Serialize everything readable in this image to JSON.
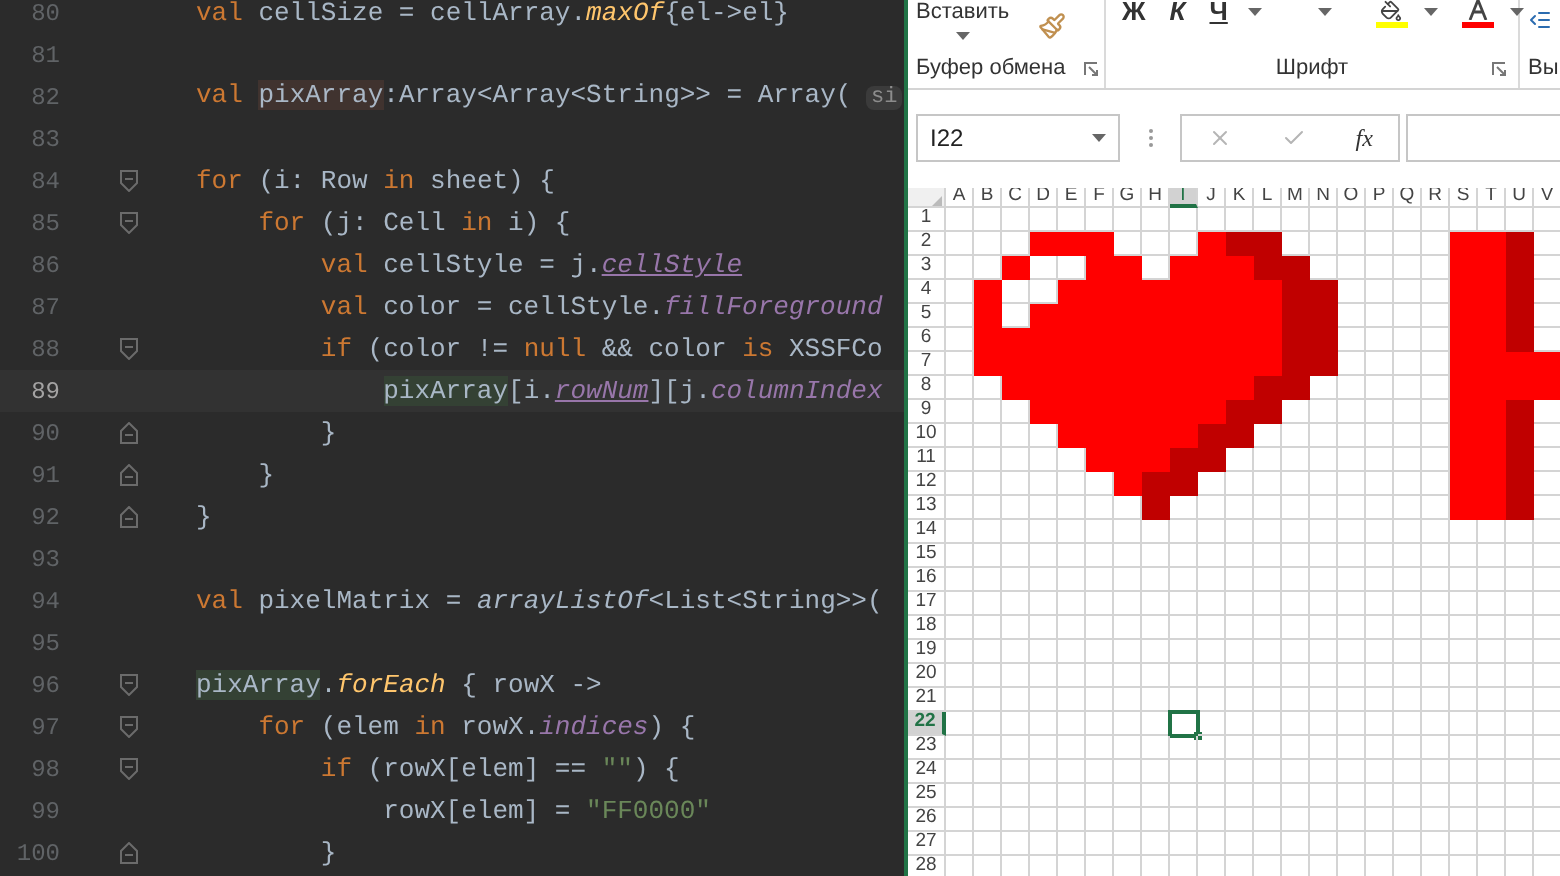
{
  "editor": {
    "lines": [
      {
        "number": "80",
        "fold_start": false,
        "fold_end": false,
        "current": false,
        "tokens": [
          {
            "kind": "keyword",
            "text": "val"
          },
          {
            "kind": "plain",
            "text": " cellSize = cellArray."
          },
          {
            "kind": "function",
            "text": "maxOf"
          },
          {
            "kind": "plain",
            "text": "{el->el}"
          }
        ]
      },
      {
        "number": "81",
        "fold_start": false,
        "fold_end": false,
        "current": false
      },
      {
        "number": "82",
        "fold_start": false,
        "fold_end": false,
        "current": false,
        "tokens": [
          {
            "kind": "keyword",
            "text": "val "
          },
          {
            "kind": "declaration",
            "text": "pixArray"
          },
          {
            "kind": "plain",
            "text": ":Array<Array<String>> = Array( "
          },
          {
            "kind": "hint",
            "text": "si"
          }
        ]
      },
      {
        "number": "83",
        "fold_start": false,
        "fold_end": false,
        "current": false
      },
      {
        "number": "84",
        "fold_start": true,
        "fold_end": false,
        "current": false,
        "tokens": [
          {
            "kind": "keyword",
            "text": "for"
          },
          {
            "kind": "plain",
            "text": " (i: Row "
          },
          {
            "kind": "keyword",
            "text": "in"
          },
          {
            "kind": "plain",
            "text": " sheet) {"
          }
        ],
        "children": [
          {
            "number": "85",
            "fold_start": true,
            "fold_end": false,
            "current": false,
            "tokens": [
              {
                "kind": "keyword",
                "text": "for"
              },
              {
                "kind": "plain",
                "text": " (j: Cell "
              },
              {
                "kind": "keyword",
                "text": "in"
              },
              {
                "kind": "plain",
                "text": " i) {"
              }
            ],
            "children": [
              {
                "number": "86",
                "fold_start": false,
                "fold_end": false,
                "current": false,
                "tokens": [
                  {
                    "kind": "keyword",
                    "text": "val"
                  },
                  {
                    "kind": "plain",
                    "text": " cellStyle = j."
                  },
                  {
                    "kind": "property-underlined",
                    "text": "cellStyle"
                  }
                ]
              },
              {
                "number": "87",
                "fold_start": false,
                "fold_end": false,
                "current": false,
                "tokens": [
                  {
                    "kind": "keyword",
                    "text": "val"
                  },
                  {
                    "kind": "plain",
                    "text": " color = cellStyle."
                  },
                  {
                    "kind": "property",
                    "text": "fillForeground"
                  }
                ]
              },
              {
                "number": "88",
                "fold_start": true,
                "fold_end": false,
                "current": false,
                "tokens": [
                  {
                    "kind": "keyword",
                    "text": "if"
                  },
                  {
                    "kind": "plain",
                    "text": " (color != "
                  },
                  {
                    "kind": "keyword",
                    "text": "null"
                  },
                  {
                    "kind": "plain",
                    "text": " && color "
                  },
                  {
                    "kind": "keyword",
                    "text": "is"
                  },
                  {
                    "kind": "plain",
                    "text": " XSSFCo"
                  }
                ],
                "children": [
                  {
                    "number": "89",
                    "fold_start": false,
                    "fold_end": false,
                    "current": true,
                    "tokens": [
                      {
                        "kind": "usage",
                        "text": "pixArray"
                      },
                      {
                        "kind": "plain",
                        "text": "[i."
                      },
                      {
                        "kind": "property-underlined",
                        "text": "rowNum"
                      },
                      {
                        "kind": "plain",
                        "text": "][j."
                      },
                      {
                        "kind": "property",
                        "text": "columnIndex"
                      }
                    ]
                  }
                ]
              },
              {
                "number": "90",
                "fold_start": false,
                "fold_end": true,
                "current": false,
                "tokens": [
                  {
                    "kind": "plain",
                    "text": "}"
                  }
                ]
              }
            ]
          },
          {
            "number": "91",
            "fold_start": false,
            "fold_end": true,
            "current": false,
            "tokens": [
              {
                "kind": "plain",
                "text": "}"
              }
            ]
          }
        ]
      },
      {
        "number": "92",
        "fold_start": false,
        "fold_end": true,
        "current": false,
        "tokens": [
          {
            "kind": "plain",
            "text": "}"
          }
        ]
      },
      {
        "number": "93",
        "fold_start": false,
        "fold_end": false,
        "current": false
      },
      {
        "number": "94",
        "fold_start": false,
        "fold_end": false,
        "current": false,
        "tokens": [
          {
            "kind": "keyword",
            "text": "val"
          },
          {
            "kind": "plain",
            "text": " pixelMatrix = "
          },
          {
            "kind": "static-function",
            "text": "arrayListOf"
          },
          {
            "kind": "plain",
            "text": "<List<String>>("
          }
        ]
      },
      {
        "number": "95",
        "fold_start": false,
        "fold_end": false,
        "current": false
      },
      {
        "number": "96",
        "fold_start": true,
        "fold_end": false,
        "current": false,
        "tokens": [
          {
            "kind": "usage",
            "text": "pixArray"
          },
          {
            "kind": "plain",
            "text": "."
          },
          {
            "kind": "function",
            "text": "forEach"
          },
          {
            "kind": "plain",
            "text": " { rowX ->"
          }
        ],
        "children": [
          {
            "number": "97",
            "fold_start": true,
            "fold_end": false,
            "current": false,
            "tokens": [
              {
                "kind": "keyword",
                "text": "for"
              },
              {
                "kind": "plain",
                "text": " (elem "
              },
              {
                "kind": "keyword",
                "text": "in"
              },
              {
                "kind": "plain",
                "text": " rowX."
              },
              {
                "kind": "property",
                "text": "indices"
              },
              {
                "kind": "plain",
                "text": ") {"
              }
            ],
            "children": [
              {
                "number": "98",
                "fold_start": true,
                "fold_end": false,
                "current": false,
                "tokens": [
                  {
                    "kind": "keyword",
                    "text": "if"
                  },
                  {
                    "kind": "plain",
                    "text": " (rowX[elem] == "
                  },
                  {
                    "kind": "string",
                    "text": "\"\""
                  },
                  {
                    "kind": "plain",
                    "text": ") {"
                  }
                ],
                "children": [
                  {
                    "number": "99",
                    "fold_start": false,
                    "fold_end": false,
                    "current": false,
                    "tokens": [
                      {
                        "kind": "plain",
                        "text": "rowX[elem] = "
                      },
                      {
                        "kind": "string",
                        "text": "\"FF0000\""
                      }
                    ]
                  }
                ]
              },
              {
                "number": "100",
                "fold_start": false,
                "fold_end": true,
                "current": false,
                "tokens": [
                  {
                    "kind": "plain",
                    "text": "}"
                  }
                ]
              }
            ]
          }
        ]
      }
    ]
  },
  "excel": {
    "ribbon": {
      "groups": [
        {
          "kind": "clipboard",
          "label": "Буфер обмена",
          "paste_label": "Вставить"
        },
        {
          "kind": "font",
          "label": "Шрифт",
          "format_buttons": [
            {
              "kind": "bold",
              "text": "Ж"
            },
            {
              "kind": "italic",
              "text": "К"
            },
            {
              "kind": "underline",
              "text": "Ч"
            }
          ],
          "fill_color": {
            "color": "#ffff00"
          },
          "font_color": {
            "color": "#ff0000"
          }
        },
        {
          "kind": "partial",
          "label": "Вы"
        }
      ]
    },
    "name_box": {
      "value": "I22"
    },
    "formula_bar": {
      "function_label": "fx"
    },
    "columns": [
      {
        "label": "A",
        "selected": false
      },
      {
        "label": "B",
        "selected": false
      },
      {
        "label": "C",
        "selected": false
      },
      {
        "label": "D",
        "selected": false
      },
      {
        "label": "E",
        "selected": false
      },
      {
        "label": "F",
        "selected": false
      },
      {
        "label": "G",
        "selected": false
      },
      {
        "label": "H",
        "selected": false
      },
      {
        "label": "I",
        "selected": true
      },
      {
        "label": "J",
        "selected": false
      },
      {
        "label": "K",
        "selected": false
      },
      {
        "label": "L",
        "selected": false
      },
      {
        "label": "M",
        "selected": false
      },
      {
        "label": "N",
        "selected": false
      },
      {
        "label": "O",
        "selected": false
      },
      {
        "label": "P",
        "selected": false
      },
      {
        "label": "Q",
        "selected": false
      },
      {
        "label": "R",
        "selected": false
      },
      {
        "label": "S",
        "selected": false
      },
      {
        "label": "T",
        "selected": false
      },
      {
        "label": "U",
        "selected": false
      },
      {
        "label": "V",
        "selected": false
      }
    ],
    "rows": [
      {
        "label": "1",
        "selected": false
      },
      {
        "label": "2",
        "selected": false,
        "cells": [
          {
            "kind": "blank"
          },
          {
            "kind": "blank"
          },
          {
            "kind": "blank"
          },
          {
            "kind": "fill",
            "color": "#ff0000"
          },
          {
            "kind": "fill",
            "color": "#ff0000"
          },
          {
            "kind": "fill",
            "color": "#ff0000"
          },
          {
            "kind": "blank"
          },
          {
            "kind": "blank"
          },
          {
            "kind": "blank"
          },
          {
            "kind": "fill",
            "color": "#ff0000"
          },
          {
            "kind": "fill",
            "color": "#c00000"
          },
          {
            "kind": "fill",
            "color": "#c00000"
          },
          {
            "kind": "blank"
          },
          {
            "kind": "blank"
          },
          {
            "kind": "blank"
          },
          {
            "kind": "blank"
          },
          {
            "kind": "blank"
          },
          {
            "kind": "blank"
          },
          {
            "kind": "fill",
            "color": "#ff0000"
          },
          {
            "kind": "fill",
            "color": "#ff0000"
          },
          {
            "kind": "fill",
            "color": "#c00000"
          },
          {
            "kind": "blank"
          }
        ]
      },
      {
        "label": "3",
        "selected": false,
        "cells": [
          {
            "kind": "blank"
          },
          {
            "kind": "blank"
          },
          {
            "kind": "fill",
            "color": "#ff0000"
          },
          {
            "kind": "blank"
          },
          {
            "kind": "blank"
          },
          {
            "kind": "fill",
            "color": "#ff0000"
          },
          {
            "kind": "fill",
            "color": "#ff0000"
          },
          {
            "kind": "blank"
          },
          {
            "kind": "fill",
            "color": "#ff0000"
          },
          {
            "kind": "fill",
            "color": "#ff0000"
          },
          {
            "kind": "fill",
            "color": "#ff0000"
          },
          {
            "kind": "fill",
            "color": "#c00000"
          },
          {
            "kind": "fill",
            "color": "#c00000"
          },
          {
            "kind": "blank"
          },
          {
            "kind": "blank"
          },
          {
            "kind": "blank"
          },
          {
            "kind": "blank"
          },
          {
            "kind": "blank"
          },
          {
            "kind": "fill",
            "color": "#ff0000"
          },
          {
            "kind": "fill",
            "color": "#ff0000"
          },
          {
            "kind": "fill",
            "color": "#c00000"
          },
          {
            "kind": "blank"
          }
        ]
      },
      {
        "label": "4",
        "selected": false,
        "cells": [
          {
            "kind": "blank"
          },
          {
            "kind": "fill",
            "color": "#ff0000"
          },
          {
            "kind": "blank"
          },
          {
            "kind": "blank"
          },
          {
            "kind": "fill",
            "color": "#ff0000"
          },
          {
            "kind": "fill",
            "color": "#ff0000"
          },
          {
            "kind": "fill",
            "color": "#ff0000"
          },
          {
            "kind": "fill",
            "color": "#ff0000"
          },
          {
            "kind": "fill",
            "color": "#ff0000"
          },
          {
            "kind": "fill",
            "color": "#ff0000"
          },
          {
            "kind": "fill",
            "color": "#ff0000"
          },
          {
            "kind": "fill",
            "color": "#ff0000"
          },
          {
            "kind": "fill",
            "color": "#c00000"
          },
          {
            "kind": "fill",
            "color": "#c00000"
          },
          {
            "kind": "blank"
          },
          {
            "kind": "blank"
          },
          {
            "kind": "blank"
          },
          {
            "kind": "blank"
          },
          {
            "kind": "fill",
            "color": "#ff0000"
          },
          {
            "kind": "fill",
            "color": "#ff0000"
          },
          {
            "kind": "fill",
            "color": "#c00000"
          },
          {
            "kind": "blank"
          }
        ]
      },
      {
        "label": "5",
        "selected": false,
        "cells": [
          {
            "kind": "blank"
          },
          {
            "kind": "fill",
            "color": "#ff0000"
          },
          {
            "kind": "blank"
          },
          {
            "kind": "fill",
            "color": "#ff0000"
          },
          {
            "kind": "fill",
            "color": "#ff0000"
          },
          {
            "kind": "fill",
            "color": "#ff0000"
          },
          {
            "kind": "fill",
            "color": "#ff0000"
          },
          {
            "kind": "fill",
            "color": "#ff0000"
          },
          {
            "kind": "fill",
            "color": "#ff0000"
          },
          {
            "kind": "fill",
            "color": "#ff0000"
          },
          {
            "kind": "fill",
            "color": "#ff0000"
          },
          {
            "kind": "fill",
            "color": "#ff0000"
          },
          {
            "kind": "fill",
            "color": "#c00000"
          },
          {
            "kind": "fill",
            "color": "#c00000"
          },
          {
            "kind": "blank"
          },
          {
            "kind": "blank"
          },
          {
            "kind": "blank"
          },
          {
            "kind": "blank"
          },
          {
            "kind": "fill",
            "color": "#ff0000"
          },
          {
            "kind": "fill",
            "color": "#ff0000"
          },
          {
            "kind": "fill",
            "color": "#c00000"
          },
          {
            "kind": "blank"
          }
        ]
      },
      {
        "label": "6",
        "selected": false,
        "cells": [
          {
            "kind": "blank"
          },
          {
            "kind": "fill",
            "color": "#ff0000"
          },
          {
            "kind": "fill",
            "color": "#ff0000"
          },
          {
            "kind": "fill",
            "color": "#ff0000"
          },
          {
            "kind": "fill",
            "color": "#ff0000"
          },
          {
            "kind": "fill",
            "color": "#ff0000"
          },
          {
            "kind": "fill",
            "color": "#ff0000"
          },
          {
            "kind": "fill",
            "color": "#ff0000"
          },
          {
            "kind": "fill",
            "color": "#ff0000"
          },
          {
            "kind": "fill",
            "color": "#ff0000"
          },
          {
            "kind": "fill",
            "color": "#ff0000"
          },
          {
            "kind": "fill",
            "color": "#ff0000"
          },
          {
            "kind": "fill",
            "color": "#c00000"
          },
          {
            "kind": "fill",
            "color": "#c00000"
          },
          {
            "kind": "blank"
          },
          {
            "kind": "blank"
          },
          {
            "kind": "blank"
          },
          {
            "kind": "blank"
          },
          {
            "kind": "fill",
            "color": "#ff0000"
          },
          {
            "kind": "fill",
            "color": "#ff0000"
          },
          {
            "kind": "fill",
            "color": "#c00000"
          },
          {
            "kind": "blank"
          }
        ]
      },
      {
        "label": "7",
        "selected": false,
        "cells": [
          {
            "kind": "blank"
          },
          {
            "kind": "fill",
            "color": "#ff0000"
          },
          {
            "kind": "fill",
            "color": "#ff0000"
          },
          {
            "kind": "fill",
            "color": "#ff0000"
          },
          {
            "kind": "fill",
            "color": "#ff0000"
          },
          {
            "kind": "fill",
            "color": "#ff0000"
          },
          {
            "kind": "fill",
            "color": "#ff0000"
          },
          {
            "kind": "fill",
            "color": "#ff0000"
          },
          {
            "kind": "fill",
            "color": "#ff0000"
          },
          {
            "kind": "fill",
            "color": "#ff0000"
          },
          {
            "kind": "fill",
            "color": "#ff0000"
          },
          {
            "kind": "fill",
            "color": "#ff0000"
          },
          {
            "kind": "fill",
            "color": "#c00000"
          },
          {
            "kind": "fill",
            "color": "#c00000"
          },
          {
            "kind": "blank"
          },
          {
            "kind": "blank"
          },
          {
            "kind": "blank"
          },
          {
            "kind": "blank"
          },
          {
            "kind": "fill",
            "color": "#ff0000"
          },
          {
            "kind": "fill",
            "color": "#ff0000"
          },
          {
            "kind": "fill",
            "color": "#ff0000"
          },
          {
            "kind": "fill",
            "color": "#ff0000"
          }
        ]
      },
      {
        "label": "8",
        "selected": false,
        "cells": [
          {
            "kind": "blank"
          },
          {
            "kind": "blank"
          },
          {
            "kind": "fill",
            "color": "#ff0000"
          },
          {
            "kind": "fill",
            "color": "#ff0000"
          },
          {
            "kind": "fill",
            "color": "#ff0000"
          },
          {
            "kind": "fill",
            "color": "#ff0000"
          },
          {
            "kind": "fill",
            "color": "#ff0000"
          },
          {
            "kind": "fill",
            "color": "#ff0000"
          },
          {
            "kind": "fill",
            "color": "#ff0000"
          },
          {
            "kind": "fill",
            "color": "#ff0000"
          },
          {
            "kind": "fill",
            "color": "#ff0000"
          },
          {
            "kind": "fill",
            "color": "#c00000"
          },
          {
            "kind": "fill",
            "color": "#c00000"
          },
          {
            "kind": "blank"
          },
          {
            "kind": "blank"
          },
          {
            "kind": "blank"
          },
          {
            "kind": "blank"
          },
          {
            "kind": "blank"
          },
          {
            "kind": "fill",
            "color": "#ff0000"
          },
          {
            "kind": "fill",
            "color": "#ff0000"
          },
          {
            "kind": "fill",
            "color": "#ff0000"
          },
          {
            "kind": "fill",
            "color": "#ff0000"
          }
        ]
      },
      {
        "label": "9",
        "selected": false,
        "cells": [
          {
            "kind": "blank"
          },
          {
            "kind": "blank"
          },
          {
            "kind": "blank"
          },
          {
            "kind": "fill",
            "color": "#ff0000"
          },
          {
            "kind": "fill",
            "color": "#ff0000"
          },
          {
            "kind": "fill",
            "color": "#ff0000"
          },
          {
            "kind": "fill",
            "color": "#ff0000"
          },
          {
            "kind": "fill",
            "color": "#ff0000"
          },
          {
            "kind": "fill",
            "color": "#ff0000"
          },
          {
            "kind": "fill",
            "color": "#ff0000"
          },
          {
            "kind": "fill",
            "color": "#c00000"
          },
          {
            "kind": "fill",
            "color": "#c00000"
          },
          {
            "kind": "blank"
          },
          {
            "kind": "blank"
          },
          {
            "kind": "blank"
          },
          {
            "kind": "blank"
          },
          {
            "kind": "blank"
          },
          {
            "kind": "blank"
          },
          {
            "kind": "fill",
            "color": "#ff0000"
          },
          {
            "kind": "fill",
            "color": "#ff0000"
          },
          {
            "kind": "fill",
            "color": "#c00000"
          },
          {
            "kind": "blank"
          }
        ]
      },
      {
        "label": "10",
        "selected": false,
        "cells": [
          {
            "kind": "blank"
          },
          {
            "kind": "blank"
          },
          {
            "kind": "blank"
          },
          {
            "kind": "blank"
          },
          {
            "kind": "fill",
            "color": "#ff0000"
          },
          {
            "kind": "fill",
            "color": "#ff0000"
          },
          {
            "kind": "fill",
            "color": "#ff0000"
          },
          {
            "kind": "fill",
            "color": "#ff0000"
          },
          {
            "kind": "fill",
            "color": "#ff0000"
          },
          {
            "kind": "fill",
            "color": "#c00000"
          },
          {
            "kind": "fill",
            "color": "#c00000"
          },
          {
            "kind": "blank"
          },
          {
            "kind": "blank"
          },
          {
            "kind": "blank"
          },
          {
            "kind": "blank"
          },
          {
            "kind": "blank"
          },
          {
            "kind": "blank"
          },
          {
            "kind": "blank"
          },
          {
            "kind": "fill",
            "color": "#ff0000"
          },
          {
            "kind": "fill",
            "color": "#ff0000"
          },
          {
            "kind": "fill",
            "color": "#c00000"
          },
          {
            "kind": "blank"
          }
        ]
      },
      {
        "label": "11",
        "selected": false,
        "cells": [
          {
            "kind": "blank"
          },
          {
            "kind": "blank"
          },
          {
            "kind": "blank"
          },
          {
            "kind": "blank"
          },
          {
            "kind": "blank"
          },
          {
            "kind": "fill",
            "color": "#ff0000"
          },
          {
            "kind": "fill",
            "color": "#ff0000"
          },
          {
            "kind": "fill",
            "color": "#ff0000"
          },
          {
            "kind": "fill",
            "color": "#c00000"
          },
          {
            "kind": "fill",
            "color": "#c00000"
          },
          {
            "kind": "blank"
          },
          {
            "kind": "blank"
          },
          {
            "kind": "blank"
          },
          {
            "kind": "blank"
          },
          {
            "kind": "blank"
          },
          {
            "kind": "blank"
          },
          {
            "kind": "blank"
          },
          {
            "kind": "blank"
          },
          {
            "kind": "fill",
            "color": "#ff0000"
          },
          {
            "kind": "fill",
            "color": "#ff0000"
          },
          {
            "kind": "fill",
            "color": "#c00000"
          },
          {
            "kind": "blank"
          }
        ]
      },
      {
        "label": "12",
        "selected": false,
        "cells": [
          {
            "kind": "blank"
          },
          {
            "kind": "blank"
          },
          {
            "kind": "blank"
          },
          {
            "kind": "blank"
          },
          {
            "kind": "blank"
          },
          {
            "kind": "blank"
          },
          {
            "kind": "fill",
            "color": "#ff0000"
          },
          {
            "kind": "fill",
            "color": "#c00000"
          },
          {
            "kind": "fill",
            "color": "#c00000"
          },
          {
            "kind": "blank"
          },
          {
            "kind": "blank"
          },
          {
            "kind": "blank"
          },
          {
            "kind": "blank"
          },
          {
            "kind": "blank"
          },
          {
            "kind": "blank"
          },
          {
            "kind": "blank"
          },
          {
            "kind": "blank"
          },
          {
            "kind": "blank"
          },
          {
            "kind": "fill",
            "color": "#ff0000"
          },
          {
            "kind": "fill",
            "color": "#ff0000"
          },
          {
            "kind": "fill",
            "color": "#c00000"
          },
          {
            "kind": "blank"
          }
        ]
      },
      {
        "label": "13",
        "selected": false,
        "cells": [
          {
            "kind": "blank"
          },
          {
            "kind": "blank"
          },
          {
            "kind": "blank"
          },
          {
            "kind": "blank"
          },
          {
            "kind": "blank"
          },
          {
            "kind": "blank"
          },
          {
            "kind": "blank"
          },
          {
            "kind": "fill",
            "color": "#c00000"
          },
          {
            "kind": "blank"
          },
          {
            "kind": "blank"
          },
          {
            "kind": "blank"
          },
          {
            "kind": "blank"
          },
          {
            "kind": "blank"
          },
          {
            "kind": "blank"
          },
          {
            "kind": "blank"
          },
          {
            "kind": "blank"
          },
          {
            "kind": "blank"
          },
          {
            "kind": "blank"
          },
          {
            "kind": "fill",
            "color": "#ff0000"
          },
          {
            "kind": "fill",
            "color": "#ff0000"
          },
          {
            "kind": "fill",
            "color": "#c00000"
          },
          {
            "kind": "blank"
          }
        ]
      },
      {
        "label": "14",
        "selected": false
      },
      {
        "label": "15",
        "selected": false
      },
      {
        "label": "16",
        "selected": false
      },
      {
        "label": "17",
        "selected": false
      },
      {
        "label": "18",
        "selected": false
      },
      {
        "label": "19",
        "selected": false
      },
      {
        "label": "20",
        "selected": false
      },
      {
        "label": "21",
        "selected": false
      },
      {
        "label": "22",
        "selected": true
      },
      {
        "label": "23",
        "selected": false
      },
      {
        "label": "24",
        "selected": false
      },
      {
        "label": "25",
        "selected": false
      },
      {
        "label": "26",
        "selected": false
      },
      {
        "label": "27",
        "selected": false
      },
      {
        "label": "28",
        "selected": false
      }
    ]
  }
}
